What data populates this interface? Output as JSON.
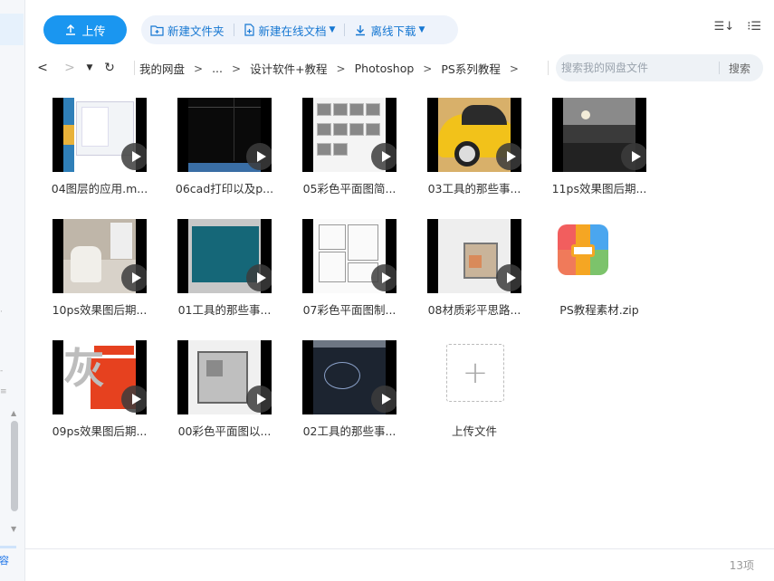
{
  "toolbar": {
    "upload_label": "上传",
    "actions": [
      {
        "label": "新建文件夹",
        "icon": "folder-plus-icon",
        "caret": ""
      },
      {
        "label": "新建在线文档",
        "icon": "doc-plus-icon",
        "caret": "▼"
      },
      {
        "label": "离线下载",
        "icon": "download-icon",
        "caret": "▼"
      }
    ],
    "sort_icon": "☰↓",
    "grid_icon": "⁝☰"
  },
  "nav": {
    "back": "<",
    "forward": ">",
    "history": "▼",
    "refresh": "↻",
    "breadcrumb": [
      "我的网盘",
      "...",
      "设计软件+教程",
      "Photoshop",
      "PS系列教程"
    ],
    "separator": ">",
    "search_placeholder": "搜索我的网盘文件",
    "search_button": "搜索"
  },
  "files": [
    {
      "name": "04图层的应用.m...",
      "type": "video",
      "thumb": "04"
    },
    {
      "name": "06cad打印以及p...",
      "type": "video",
      "thumb": "06"
    },
    {
      "name": "05彩色平面图简...",
      "type": "video",
      "thumb": "05"
    },
    {
      "name": "03工具的那些事...",
      "type": "video",
      "thumb": "03"
    },
    {
      "name": "11ps效果图后期...",
      "type": "video",
      "thumb": "11"
    },
    {
      "name": "10ps效果图后期...",
      "type": "video",
      "thumb": "10"
    },
    {
      "name": "01工具的那些事...",
      "type": "video",
      "thumb": "01"
    },
    {
      "name": "07彩色平面图制...",
      "type": "video",
      "thumb": "07"
    },
    {
      "name": "08材质彩平思路...",
      "type": "video",
      "thumb": "08"
    },
    {
      "name": "PS教程素材.zip",
      "type": "zip"
    },
    {
      "name": "09ps效果图后期...",
      "type": "video",
      "thumb": "09"
    },
    {
      "name": "00彩色平面图以...",
      "type": "video",
      "thumb": "00"
    },
    {
      "name": "02工具的那些事...",
      "type": "video",
      "thumb": "02"
    }
  ],
  "upload_tile": {
    "label": "上传文件",
    "glyph": "+"
  },
  "thumb_09_glyph": "灰",
  "status": {
    "count": "13项"
  },
  "left_panel": {
    "edge_label": "扩容"
  },
  "colors": {
    "accent": "#1a96f0",
    "action_text": "#1677d2"
  }
}
